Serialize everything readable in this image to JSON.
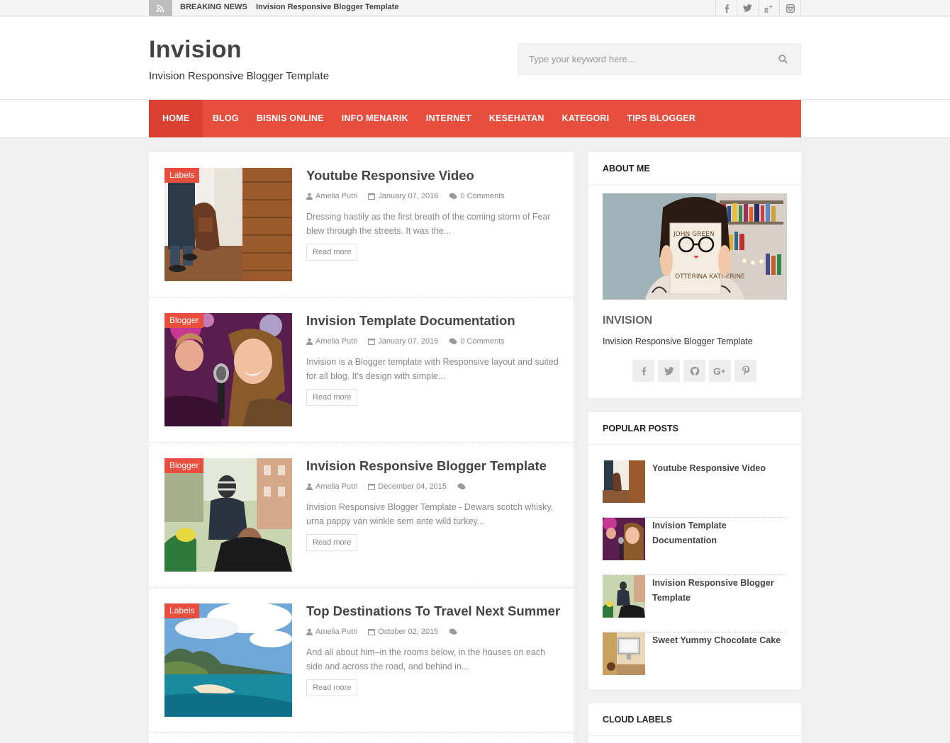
{
  "topbar": {
    "breaking_label": "BREAKING NEWS",
    "breaking_text": "Invision Responsive Blogger Template",
    "social_icons": [
      "facebook-icon",
      "twitter-icon",
      "google-plus-icon",
      "instagram-icon"
    ]
  },
  "header": {
    "title": "Invision",
    "description": "Invision Responsive Blogger Template",
    "search_placeholder": "Type your keyword here..."
  },
  "nav": {
    "items": [
      "HOME",
      "BLOG",
      "BISNIS ONLINE",
      "INFO MENARIK",
      "INTERNET",
      "KESEHATAN",
      "KATEGORI",
      "TIPS BLOGGER"
    ],
    "accent": "#e84e3d"
  },
  "posts": [
    {
      "label": "Labels",
      "title": "Youtube Responsive Video",
      "author": "Amelia Putri",
      "date": "January 07, 2016",
      "comments": "0 Comments",
      "excerpt": "Dressing hastily as the first breath of the coming storm of Fear blew through the streets. It was the...",
      "read_more": "Read more"
    },
    {
      "label": "Blogger",
      "title": "Invision Template Documentation",
      "author": "Amelia Putri",
      "date": "January 07, 2016",
      "comments": "0 Comments",
      "excerpt": "Invision is a Blogger template with Responsive layout and suited for all blog. It's design with simple...",
      "read_more": "Read more"
    },
    {
      "label": "Blogger",
      "title": "Invision Responsive Blogger Template",
      "author": "Amelia Putri",
      "date": "December 04, 2015",
      "comments": "",
      "excerpt": "Invision Responsive Blogger Template - Dewars scotch whisky, urna pappy van winkle sem ante wild turkey...",
      "read_more": "Read more"
    },
    {
      "label": "Labels",
      "title": "Top Destinations To Travel Next Summer",
      "author": "Amelia Putri",
      "date": "October 02, 2015",
      "comments": "",
      "excerpt": "And all about him–in the rooms below, in the houses on each side and across the road, and behind in...",
      "read_more": "Read more"
    }
  ],
  "sidebar": {
    "about": {
      "title": "ABOUT ME",
      "name": "INVISION",
      "description": "Invision Responsive Blogger Template",
      "book_text_top": "JOHN GREEN",
      "book_text_bottom": "OTTERINA KATHERINE",
      "social_icons": [
        "facebook-icon",
        "twitter-icon",
        "github-icon",
        "google-plus-icon",
        "pinterest-icon"
      ]
    },
    "popular": {
      "title": "POPULAR POSTS",
      "items": [
        "Youtube Responsive Video",
        "Invision Template Documentation",
        "Invision Responsive Blogger Template",
        "Sweet Yummy Chocolate Cake"
      ]
    },
    "cloud": {
      "title": "CLOUD LABELS"
    }
  }
}
